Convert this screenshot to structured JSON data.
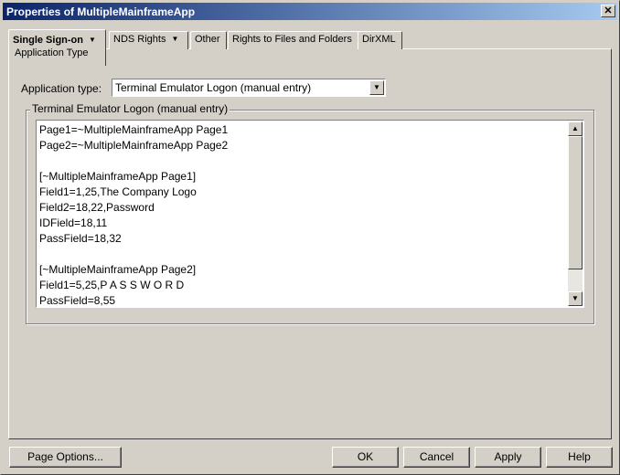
{
  "window": {
    "title": "Properties of MultipleMainframeApp",
    "close_glyph": "✕"
  },
  "tabs": [
    {
      "label": "Single Sign-on",
      "has_menu": true,
      "active": true,
      "subtab": "Application Type"
    },
    {
      "label": "NDS Rights",
      "has_menu": true
    },
    {
      "label": "Other"
    },
    {
      "label": "Rights to Files and Folders"
    },
    {
      "label": "DirXML"
    }
  ],
  "app_type": {
    "label": "Application type:",
    "value": "Terminal Emulator Logon (manual entry)"
  },
  "group": {
    "title": "Terminal Emulator Logon (manual entry)",
    "lines": [
      "Page1=~MultipleMainframeApp Page1",
      "Page2=~MultipleMainframeApp Page2",
      "",
      "[~MultipleMainframeApp Page1]",
      "Field1=1,25,The Company Logo",
      "Field2=18,22,Password",
      "IDField=18,11",
      "PassField=18,32",
      "",
      "[~MultipleMainframeApp Page2]",
      "Field1=5,25,P A S S W O R D",
      "PassField=8,55"
    ]
  },
  "buttons": {
    "page_options": "Page Options...",
    "ok": "OK",
    "cancel": "Cancel",
    "apply": "Apply",
    "help": "Help"
  }
}
